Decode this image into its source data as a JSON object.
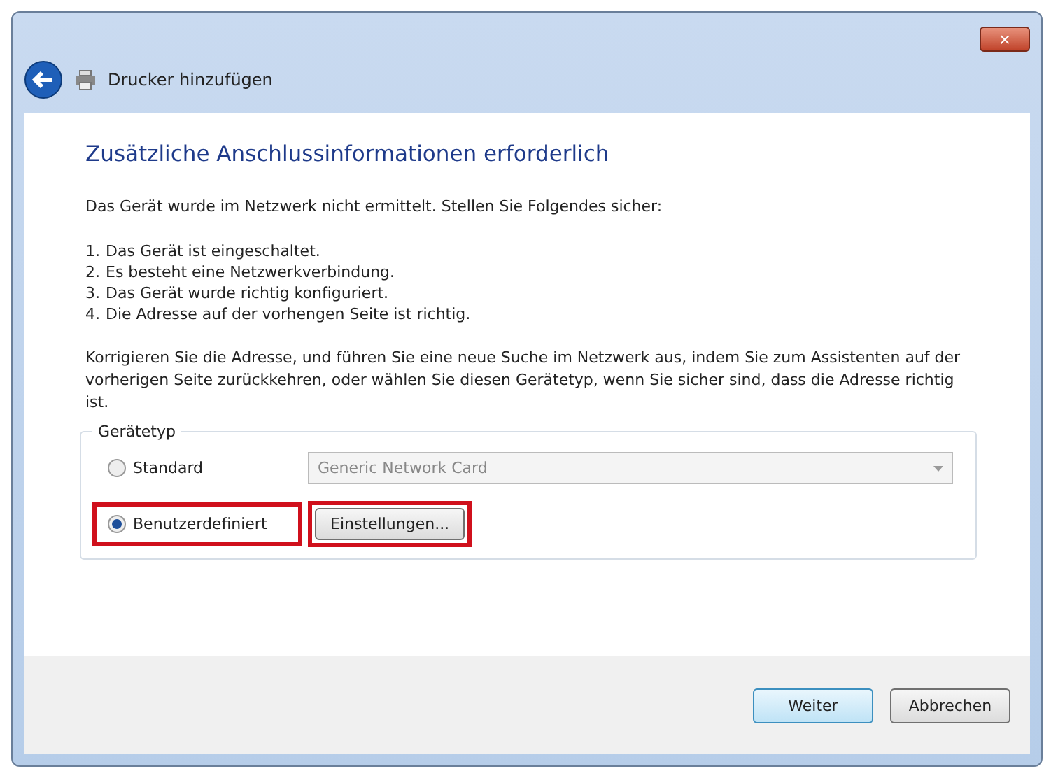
{
  "window": {
    "title": "Drucker hinzufügen",
    "close": "×"
  },
  "heading": "Zusätzliche Anschlussinformationen erforderlich",
  "intro": "Das Gerät wurde im Netzwerk nicht ermittelt. Stellen Sie Folgendes sicher:",
  "checklist": [
    {
      "number": "1.",
      "text": "Das Gerät ist eingeschaltet."
    },
    {
      "number": "2.",
      "text": "Es besteht eine Netzwerkverbindung."
    },
    {
      "number": "3.",
      "text": "Das Gerät wurde richtig konfiguriert."
    },
    {
      "number": "4.",
      "text": "Die Adresse auf der vorhengen Seite ist richtig."
    }
  ],
  "advice": "Korrigieren Sie die Adresse, und führen Sie eine neue Suche im Netzwerk aus, indem Sie zum Assistenten auf der vorherigen Seite zurückkehren, oder wählen Sie diesen Gerätetyp, wenn Sie sicher sind, dass die Adresse richtig ist.",
  "device_type": {
    "legend": "Gerätetyp",
    "options": [
      {
        "label": "Standard",
        "selected": false,
        "highlighted": false
      },
      {
        "label": "Benutzerdefiniert",
        "selected": true,
        "highlighted": true
      }
    ],
    "dropdown": {
      "value": "Generic Network Card",
      "disabled": true
    },
    "settings_button": {
      "label": "Einstellungen...",
      "highlighted": true
    }
  },
  "buttons": [
    {
      "label": "Weiter",
      "default": true
    },
    {
      "label": "Abbrechen",
      "default": false
    }
  ]
}
